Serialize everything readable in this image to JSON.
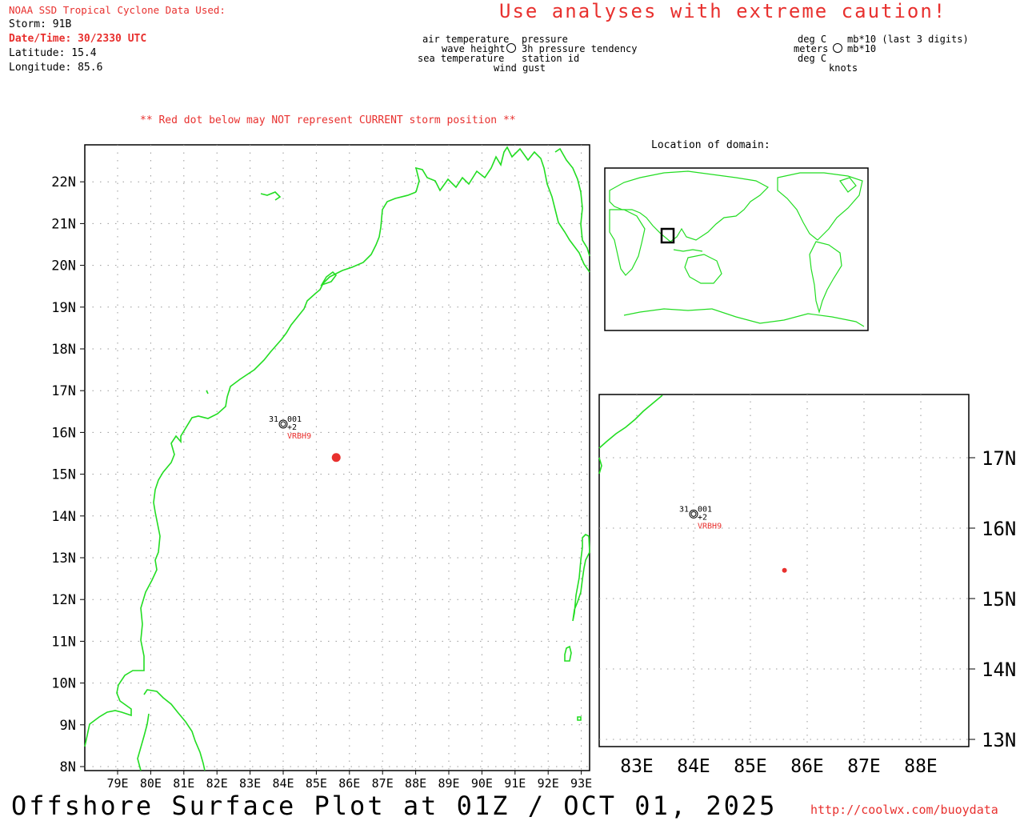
{
  "header": {
    "source": "NOAA SSD Tropical Cyclone Data Used:",
    "storm": "Storm: 91B",
    "datetime": "Date/Time: 30/2330 UTC",
    "latitude": "Latitude: 15.4",
    "longitude": "Longitude: 85.6",
    "caution": "Use analyses with extreme caution!"
  },
  "legend": {
    "left": [
      "air temperature",
      "wave height",
      "sea temperature"
    ],
    "right": [
      "pressure",
      "3h pressure tendency",
      "station id"
    ],
    "bottom": "wind gust",
    "units_left": [
      "deg C",
      "meters",
      "deg C"
    ],
    "units_right": [
      "mb*10 (last 3 digits)",
      "mb*10",
      "knots"
    ]
  },
  "warning": "** Red dot below may NOT represent CURRENT storm position **",
  "inset_title": "Location of domain:",
  "main_map": {
    "lat_labels": [
      "22N",
      "21N",
      "20N",
      "19N",
      "18N",
      "17N",
      "16N",
      "15N",
      "14N",
      "13N",
      "12N",
      "11N",
      "10N",
      "9N",
      "8N"
    ],
    "lon_labels": [
      "79E",
      "80E",
      "81E",
      "82E",
      "83E",
      "84E",
      "85E",
      "86E",
      "87E",
      "88E",
      "89E",
      "90E",
      "91E",
      "92E",
      "93E"
    ]
  },
  "zoom_map": {
    "lat_labels": [
      "17N",
      "16N",
      "15N",
      "14N",
      "13N"
    ],
    "lon_labels": [
      "83E",
      "84E",
      "85E",
      "86E",
      "87E",
      "88E"
    ]
  },
  "station": {
    "air_temp": "31",
    "pressure": "001",
    "tendency": "+2",
    "id": "VRBH9",
    "lat": 16.2,
    "lon": 84.0
  },
  "storm_position": {
    "lat": 15.4,
    "lon": 85.6
  },
  "footer": {
    "title": "Offshore Surface Plot at 01Z / OCT 01, 2025",
    "url": "http://coolwx.com/buoydata"
  },
  "colors": {
    "coast": "#22dd22",
    "red": "#e8302e",
    "grid": "#999999"
  }
}
